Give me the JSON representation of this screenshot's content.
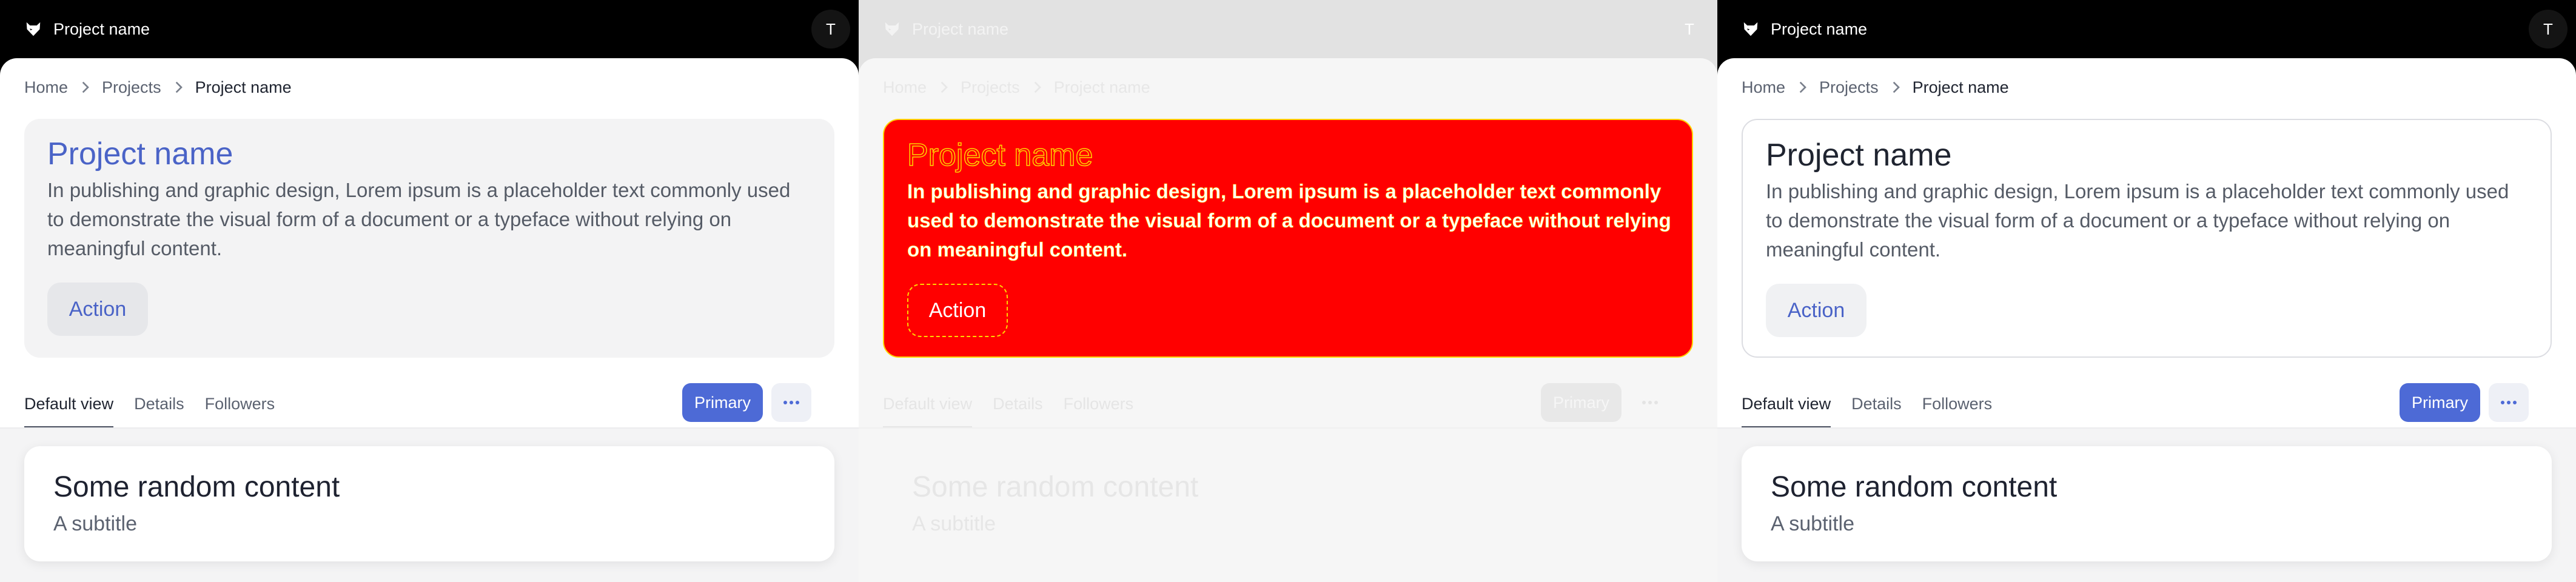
{
  "app": {
    "title": "Project name",
    "avatar_initial": "T",
    "logo_icon": "fox-logo-icon"
  },
  "breadcrumb": {
    "items": [
      "Home",
      "Projects",
      "Project name"
    ],
    "separator_icon": "chevron-right-icon"
  },
  "hero": {
    "title": "Project name",
    "description": "In publishing and graphic design, Lorem ipsum is a placeholder text commonly used to demonstrate the visual form of a document or a typeface without relying on meaningful content.",
    "action_label": "Action"
  },
  "tabs": [
    {
      "label": "Default view",
      "active": true
    },
    {
      "label": "Details",
      "active": false
    },
    {
      "label": "Followers",
      "active": false
    }
  ],
  "toolbar": {
    "primary_label": "Primary",
    "more_icon": "more-horizontal-icon"
  },
  "card": {
    "title": "Some random content",
    "subtitle": "A subtitle"
  },
  "colors": {
    "accent": "#4d6ad6",
    "topbar": "#000000",
    "highlight_fill": "#ff0000",
    "highlight_outline": "#ffd400"
  }
}
